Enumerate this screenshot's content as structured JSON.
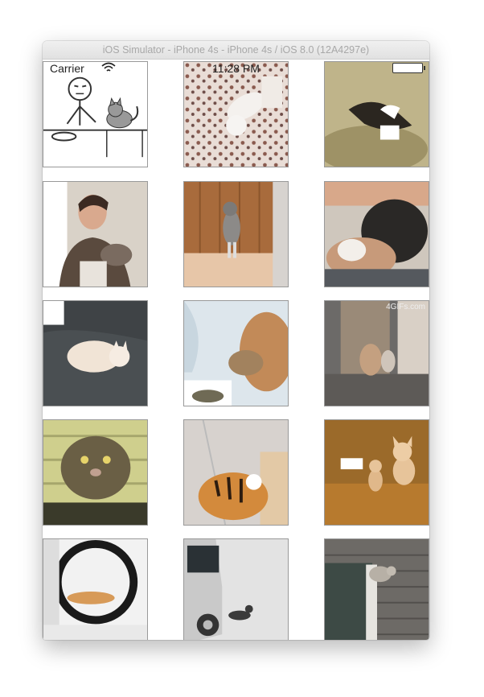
{
  "window": {
    "title": "iOS Simulator - iPhone 4s - iPhone 4s / iOS 8.0 (12A4297e)"
  },
  "status_bar": {
    "carrier": "Carrier",
    "time": "11:28 PM",
    "wifi_icon": "wifi-icon",
    "battery_icon": "battery-icon"
  },
  "gallery": {
    "columns": 3,
    "items": [
      {
        "name": "cartoon-stickman-with-cat"
      },
      {
        "name": "cat-on-floral-blanket"
      },
      {
        "name": "cat-rolling-on-floor"
      },
      {
        "name": "man-with-cat"
      },
      {
        "name": "cat-standing-on-hind-legs"
      },
      {
        "name": "cat-and-dog-cuddling"
      },
      {
        "name": "white-cat-on-bed"
      },
      {
        "name": "cat-jumping-at-curtain"
      },
      {
        "name": "cats-in-doorway",
        "watermark": "4GIFs.com"
      },
      {
        "name": "tabby-cat-closeup"
      },
      {
        "name": "tiger-cub"
      },
      {
        "name": "sand-kittens"
      },
      {
        "name": "cat-in-wheel"
      },
      {
        "name": "cat-by-car"
      },
      {
        "name": "cat-climbing-wall"
      }
    ]
  }
}
